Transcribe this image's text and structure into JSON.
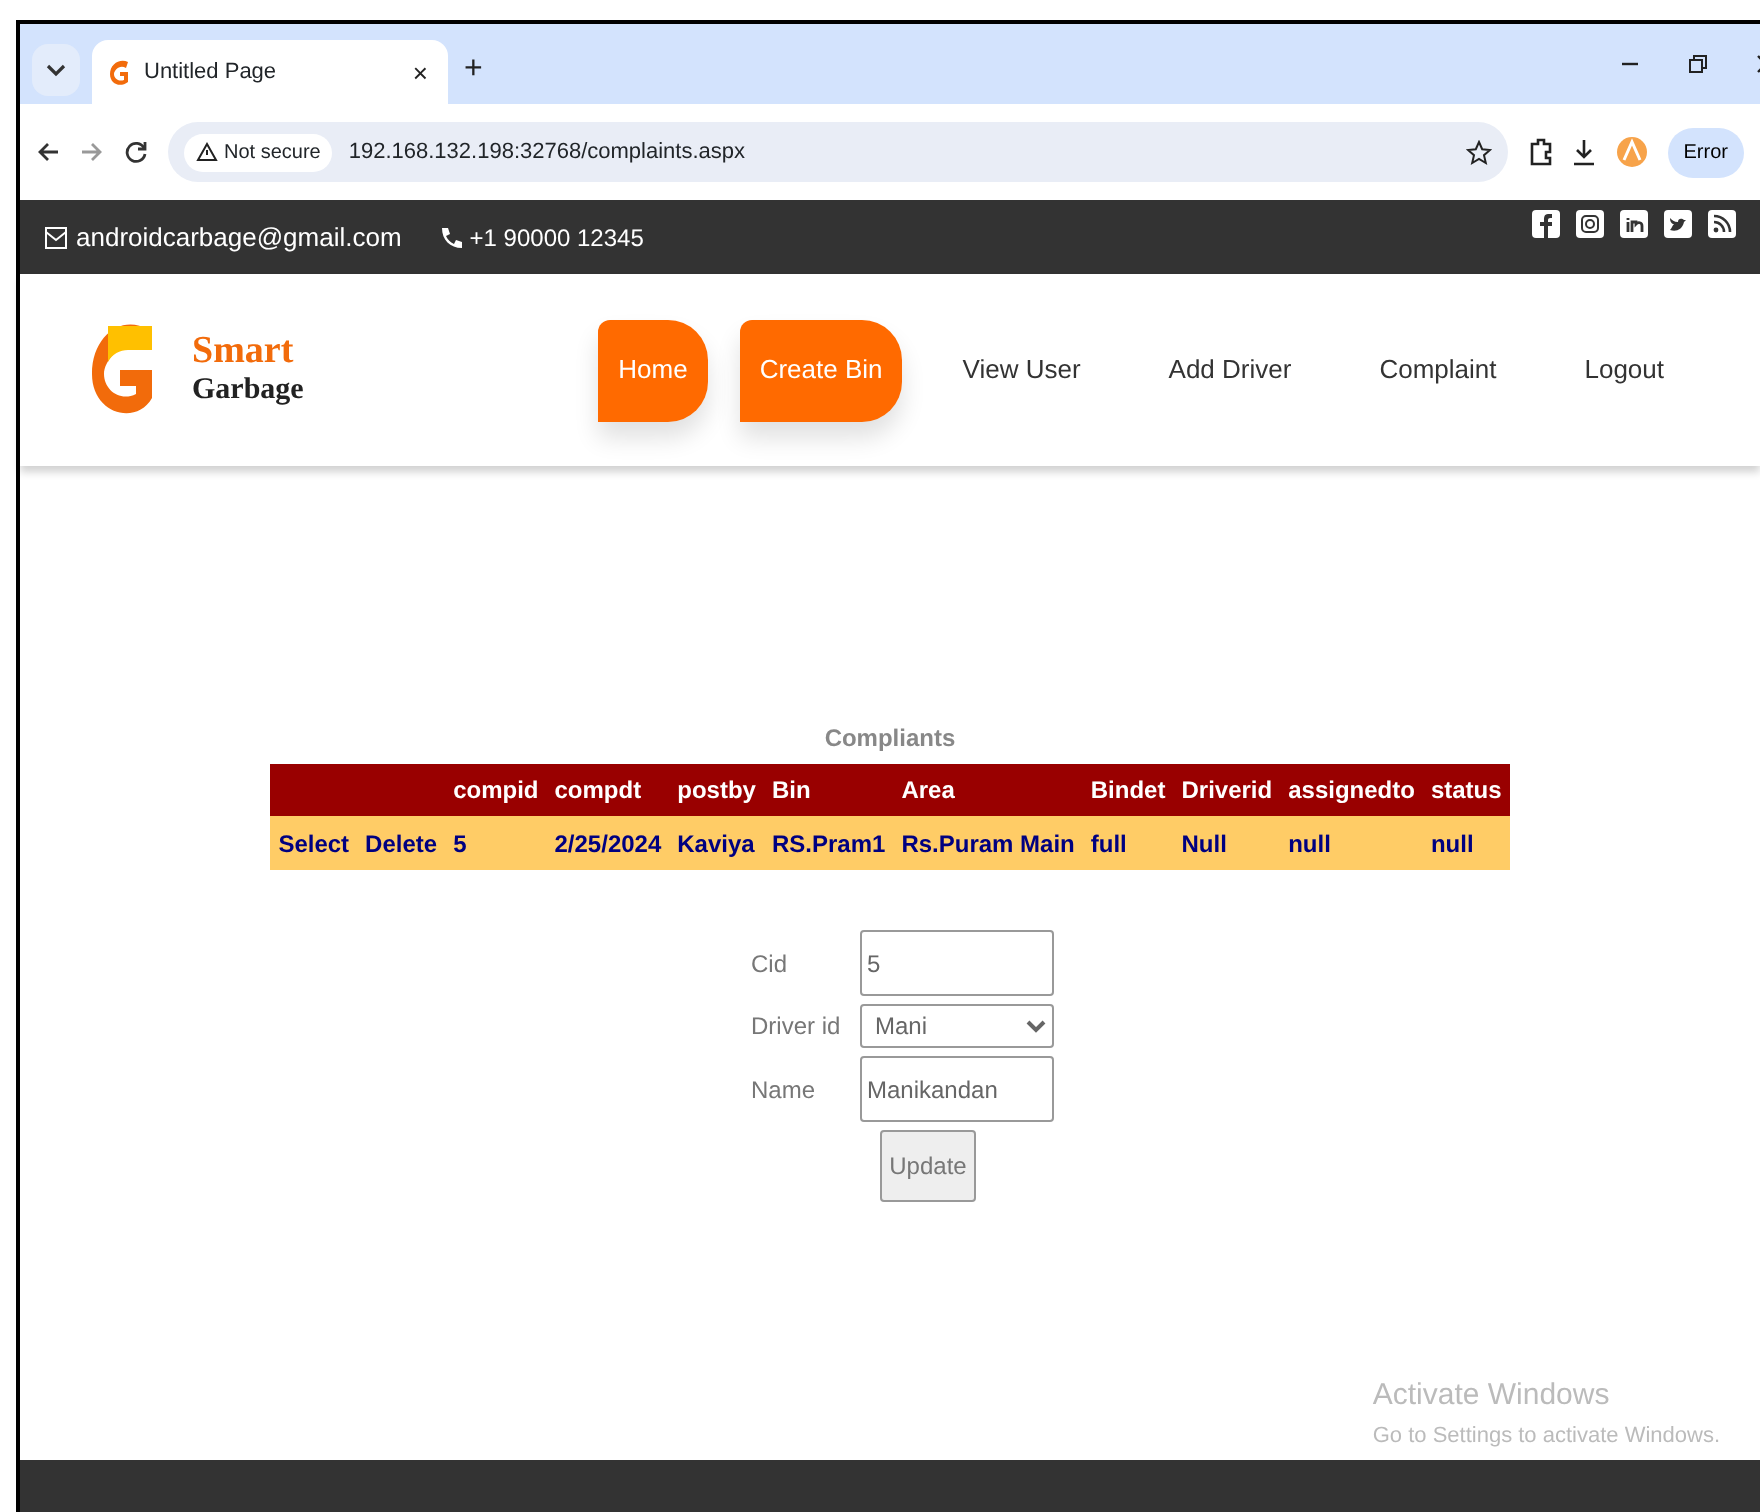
{
  "browser": {
    "tab_title": "Untitled Page",
    "tab_close": "×",
    "new_tab": "+",
    "security": "Not secure",
    "url": "192.168.132.198:32768/complaints.aspx",
    "profile": "Error"
  },
  "topbar": {
    "email": "androidcarbage@gmail.com",
    "phone": "+1 90000 12345"
  },
  "header": {
    "brand_top": "Smart",
    "brand_bottom": "Garbage",
    "nav": [
      {
        "label": "Home",
        "active": true
      },
      {
        "label": "Create Bin",
        "active": true
      },
      {
        "label": "View User",
        "active": false
      },
      {
        "label": "Add Driver",
        "active": false
      },
      {
        "label": "Complaint",
        "active": false
      },
      {
        "label": "Logout",
        "active": false
      }
    ]
  },
  "table": {
    "title": "Compliants",
    "columns": [
      "",
      "",
      "compid",
      "compdt",
      "postby",
      "Bin",
      "Area",
      "Bindet",
      "Driverid",
      "assignedto",
      "status"
    ],
    "rows": [
      [
        "Select",
        "Delete",
        "5",
        "2/25/2024",
        "Kaviya",
        "RS.Pram1",
        "Rs.Puram Main",
        "full",
        "Null",
        "null",
        "null"
      ]
    ]
  },
  "form": {
    "fields": [
      {
        "label": "Cid",
        "kind": "text",
        "value": "5"
      },
      {
        "label": "Driver id",
        "kind": "select",
        "value": "Mani"
      },
      {
        "label": "Name",
        "kind": "text",
        "value": "Manikandan"
      }
    ],
    "button": "Update"
  },
  "os_notice": {
    "title": "Activate Windows",
    "subtitle": "Go to Settings to activate Windows."
  }
}
